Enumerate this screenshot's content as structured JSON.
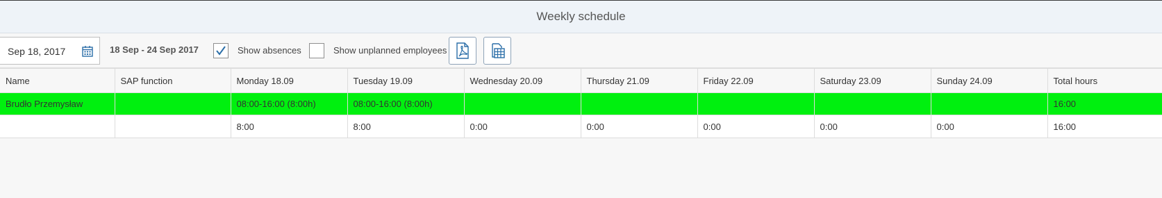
{
  "header": {
    "title": "Weekly schedule"
  },
  "toolbar": {
    "date_value": "Sep 18, 2017",
    "date_range": "18 Sep - 24 Sep 2017",
    "show_absences_label": "Show absences",
    "show_absences_checked": true,
    "show_unplanned_label": "Show unplanned employees",
    "show_unplanned_checked": false,
    "icons": [
      "calendar-icon",
      "pdf-export-icon",
      "excel-export-icon"
    ]
  },
  "table": {
    "columns": [
      "Name",
      "SAP function",
      "Monday 18.09",
      "Tuesday 19.09",
      "Wednesday 20.09",
      "Thursday 21.09",
      "Friday 22.09",
      "Saturday 23.09",
      "Sunday 24.09",
      "Total hours"
    ],
    "rows": [
      {
        "cells": [
          "Brudło Przemysław",
          "",
          "08:00-16:00 (8:00h)",
          "08:00-16:00 (8:00h)",
          "",
          "",
          "",
          "",
          "",
          "16:00"
        ],
        "highlight": "#00f00f"
      },
      {
        "cells": [
          "",
          "",
          "8:00",
          "8:00",
          "0:00",
          "0:00",
          "0:00",
          "0:00",
          "0:00",
          "16:00"
        ]
      }
    ]
  },
  "colors": {
    "highlight": "#00f00f",
    "accent": "#2b6ea8"
  }
}
